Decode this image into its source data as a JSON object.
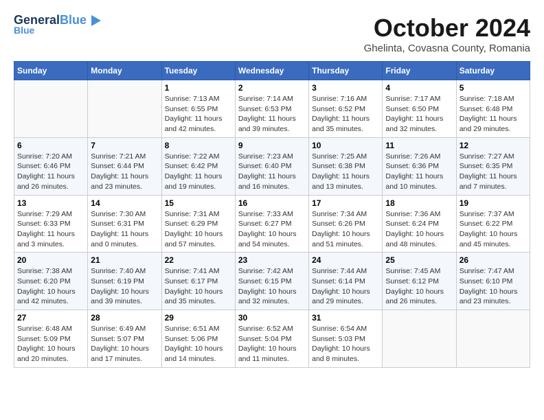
{
  "header": {
    "logo_line1": "General",
    "logo_line2": "Blue",
    "month": "October 2024",
    "location": "Ghelinta, Covasna County, Romania"
  },
  "weekdays": [
    "Sunday",
    "Monday",
    "Tuesday",
    "Wednesday",
    "Thursday",
    "Friday",
    "Saturday"
  ],
  "weeks": [
    [
      {
        "day": "",
        "info": ""
      },
      {
        "day": "",
        "info": ""
      },
      {
        "day": "1",
        "info": "Sunrise: 7:13 AM\nSunset: 6:55 PM\nDaylight: 11 hours and 42 minutes."
      },
      {
        "day": "2",
        "info": "Sunrise: 7:14 AM\nSunset: 6:53 PM\nDaylight: 11 hours and 39 minutes."
      },
      {
        "day": "3",
        "info": "Sunrise: 7:16 AM\nSunset: 6:52 PM\nDaylight: 11 hours and 35 minutes."
      },
      {
        "day": "4",
        "info": "Sunrise: 7:17 AM\nSunset: 6:50 PM\nDaylight: 11 hours and 32 minutes."
      },
      {
        "day": "5",
        "info": "Sunrise: 7:18 AM\nSunset: 6:48 PM\nDaylight: 11 hours and 29 minutes."
      }
    ],
    [
      {
        "day": "6",
        "info": "Sunrise: 7:20 AM\nSunset: 6:46 PM\nDaylight: 11 hours and 26 minutes."
      },
      {
        "day": "7",
        "info": "Sunrise: 7:21 AM\nSunset: 6:44 PM\nDaylight: 11 hours and 23 minutes."
      },
      {
        "day": "8",
        "info": "Sunrise: 7:22 AM\nSunset: 6:42 PM\nDaylight: 11 hours and 19 minutes."
      },
      {
        "day": "9",
        "info": "Sunrise: 7:23 AM\nSunset: 6:40 PM\nDaylight: 11 hours and 16 minutes."
      },
      {
        "day": "10",
        "info": "Sunrise: 7:25 AM\nSunset: 6:38 PM\nDaylight: 11 hours and 13 minutes."
      },
      {
        "day": "11",
        "info": "Sunrise: 7:26 AM\nSunset: 6:36 PM\nDaylight: 11 hours and 10 minutes."
      },
      {
        "day": "12",
        "info": "Sunrise: 7:27 AM\nSunset: 6:35 PM\nDaylight: 11 hours and 7 minutes."
      }
    ],
    [
      {
        "day": "13",
        "info": "Sunrise: 7:29 AM\nSunset: 6:33 PM\nDaylight: 11 hours and 3 minutes."
      },
      {
        "day": "14",
        "info": "Sunrise: 7:30 AM\nSunset: 6:31 PM\nDaylight: 11 hours and 0 minutes."
      },
      {
        "day": "15",
        "info": "Sunrise: 7:31 AM\nSunset: 6:29 PM\nDaylight: 10 hours and 57 minutes."
      },
      {
        "day": "16",
        "info": "Sunrise: 7:33 AM\nSunset: 6:27 PM\nDaylight: 10 hours and 54 minutes."
      },
      {
        "day": "17",
        "info": "Sunrise: 7:34 AM\nSunset: 6:26 PM\nDaylight: 10 hours and 51 minutes."
      },
      {
        "day": "18",
        "info": "Sunrise: 7:36 AM\nSunset: 6:24 PM\nDaylight: 10 hours and 48 minutes."
      },
      {
        "day": "19",
        "info": "Sunrise: 7:37 AM\nSunset: 6:22 PM\nDaylight: 10 hours and 45 minutes."
      }
    ],
    [
      {
        "day": "20",
        "info": "Sunrise: 7:38 AM\nSunset: 6:20 PM\nDaylight: 10 hours and 42 minutes."
      },
      {
        "day": "21",
        "info": "Sunrise: 7:40 AM\nSunset: 6:19 PM\nDaylight: 10 hours and 39 minutes."
      },
      {
        "day": "22",
        "info": "Sunrise: 7:41 AM\nSunset: 6:17 PM\nDaylight: 10 hours and 35 minutes."
      },
      {
        "day": "23",
        "info": "Sunrise: 7:42 AM\nSunset: 6:15 PM\nDaylight: 10 hours and 32 minutes."
      },
      {
        "day": "24",
        "info": "Sunrise: 7:44 AM\nSunset: 6:14 PM\nDaylight: 10 hours and 29 minutes."
      },
      {
        "day": "25",
        "info": "Sunrise: 7:45 AM\nSunset: 6:12 PM\nDaylight: 10 hours and 26 minutes."
      },
      {
        "day": "26",
        "info": "Sunrise: 7:47 AM\nSunset: 6:10 PM\nDaylight: 10 hours and 23 minutes."
      }
    ],
    [
      {
        "day": "27",
        "info": "Sunrise: 6:48 AM\nSunset: 5:09 PM\nDaylight: 10 hours and 20 minutes."
      },
      {
        "day": "28",
        "info": "Sunrise: 6:49 AM\nSunset: 5:07 PM\nDaylight: 10 hours and 17 minutes."
      },
      {
        "day": "29",
        "info": "Sunrise: 6:51 AM\nSunset: 5:06 PM\nDaylight: 10 hours and 14 minutes."
      },
      {
        "day": "30",
        "info": "Sunrise: 6:52 AM\nSunset: 5:04 PM\nDaylight: 10 hours and 11 minutes."
      },
      {
        "day": "31",
        "info": "Sunrise: 6:54 AM\nSunset: 5:03 PM\nDaylight: 10 hours and 8 minutes."
      },
      {
        "day": "",
        "info": ""
      },
      {
        "day": "",
        "info": ""
      }
    ]
  ]
}
